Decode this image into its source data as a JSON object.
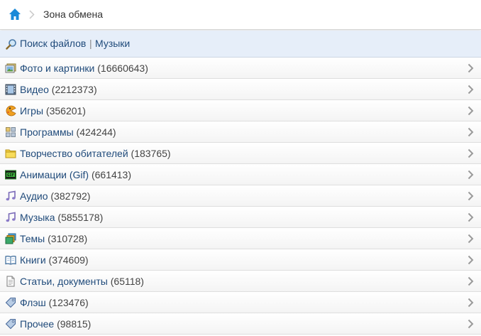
{
  "header": {
    "title": "Зона обмена",
    "home_icon": "home-icon",
    "accent": "#1a8ad8"
  },
  "search": {
    "icon": "magnifier-icon",
    "link1": "Поиск файлов",
    "separator": "|",
    "link2": "Музыки"
  },
  "categories": [
    {
      "label": "Фото и картинки",
      "count": "(16660643)",
      "icon": "photo-icon"
    },
    {
      "label": "Видео",
      "count": "(2212373)",
      "icon": "film-icon"
    },
    {
      "label": "Игры",
      "count": "(356201)",
      "icon": "pacman-icon"
    },
    {
      "label": "Программы",
      "count": "(424244)",
      "icon": "apps-grid-icon"
    },
    {
      "label": "Творчество обитателей",
      "count": "(183765)",
      "icon": "folder-icon"
    },
    {
      "label": "Анимации (Gif)",
      "count": "(661413)",
      "icon": "gif-icon"
    },
    {
      "label": "Аудио",
      "count": "(382792)",
      "icon": "music-note-icon"
    },
    {
      "label": "Музыка",
      "count": "(5855178)",
      "icon": "music-note-icon"
    },
    {
      "label": "Темы",
      "count": "(310728)",
      "icon": "themes-icon"
    },
    {
      "label": "Книги",
      "count": "(374609)",
      "icon": "book-icon"
    },
    {
      "label": "Статьи, документы",
      "count": "(65118)",
      "icon": "document-icon"
    },
    {
      "label": "Флэш",
      "count": "(123476)",
      "icon": "tag-icon"
    },
    {
      "label": "Прочее",
      "count": "(98815)",
      "icon": "tag-icon"
    }
  ]
}
